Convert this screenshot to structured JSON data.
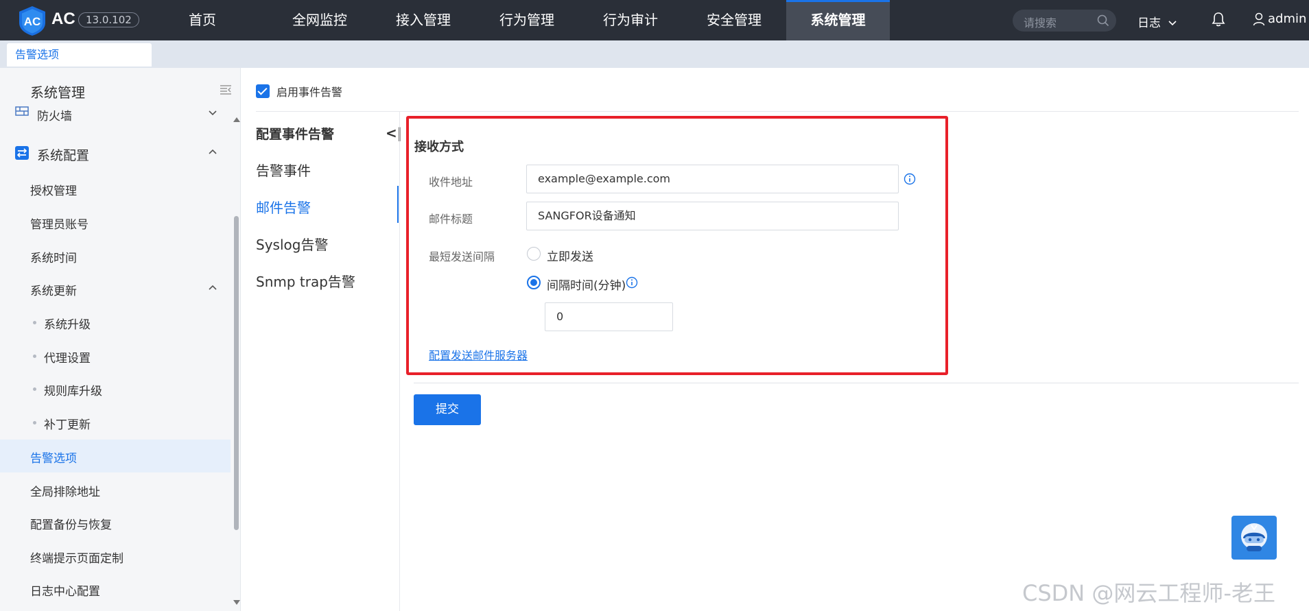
{
  "app": {
    "brand": "AC",
    "version": "13.0.102"
  },
  "nav": {
    "items": [
      "首页",
      "全网监控",
      "接入管理",
      "行为管理",
      "行为审计",
      "安全管理",
      "系统管理"
    ],
    "active": "系统管理",
    "search_placeholder": "请搜索",
    "log_menu": "日志",
    "user": "admin"
  },
  "tabs": [
    "告警选项"
  ],
  "sidebar": {
    "title": "系统管理",
    "partial_item": "防火墙",
    "group": "系统配置",
    "items": [
      {
        "label": "授权管理"
      },
      {
        "label": "管理员账号"
      },
      {
        "label": "系统时间"
      },
      {
        "label": "系统更新"
      },
      {
        "label": "系统升级"
      },
      {
        "label": "代理设置"
      },
      {
        "label": "规则库升级"
      },
      {
        "label": "补丁更新"
      },
      {
        "label": "告警选项"
      },
      {
        "label": "全局排除地址"
      },
      {
        "label": "配置备份与恢复"
      },
      {
        "label": "终端提示页面定制"
      },
      {
        "label": "日志中心配置"
      }
    ],
    "active": "告警选项"
  },
  "main": {
    "enable_label": "启用事件告警",
    "enable_checked": true,
    "subnav": {
      "title": "配置事件告警",
      "items": [
        "告警事件",
        "邮件告警",
        "Syslog告警",
        "Snmp trap告警"
      ],
      "active": "邮件告警"
    },
    "form": {
      "section_title": "接收方式",
      "recipient_label": "收件地址",
      "recipient_value": "example@example.com",
      "subject_label": "邮件标题",
      "subject_value": "SANGFOR设备通知",
      "interval_label": "最短发送间隔",
      "option_immediate": "立即发送",
      "option_interval": "间隔时间(分钟)",
      "selected_option": "间隔时间(分钟)",
      "interval_value": "0",
      "server_link": "配置发送邮件服务器"
    },
    "submit_label": "提交"
  },
  "watermark": "CSDN @网云工程师-老王",
  "colors": {
    "accent": "#1a73e8",
    "topbar": "#2a2f38",
    "highlight_box": "#e8202a"
  }
}
